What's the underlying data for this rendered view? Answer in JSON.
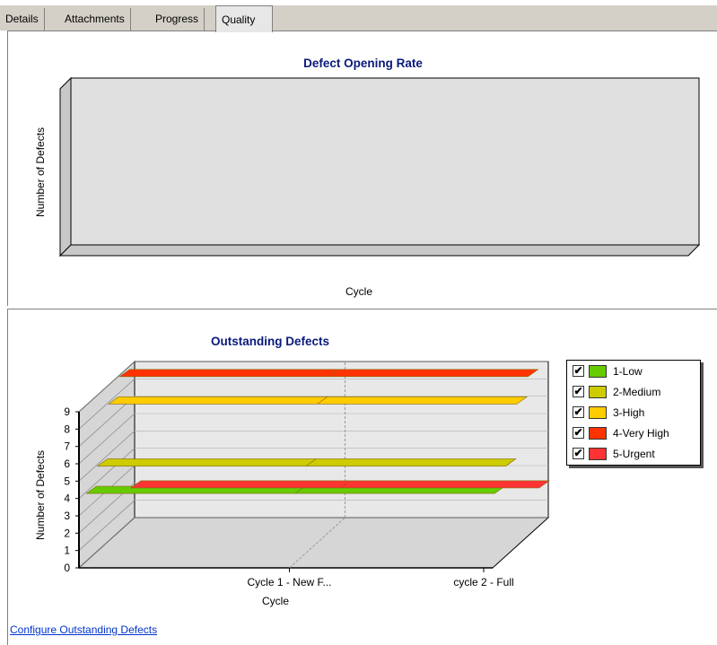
{
  "tabs": [
    {
      "label": "Details"
    },
    {
      "label": "Attachments"
    },
    {
      "label": "Progress"
    },
    {
      "label": "Quality",
      "active": true
    }
  ],
  "defect_opening_chart": {
    "title": "Defect Opening Rate",
    "xlabel": "Cycle",
    "ylabel": "Number of Defects"
  },
  "outstanding_chart": {
    "title": "Outstanding Defects",
    "xlabel": "Cycle",
    "ylabel": "Number of Defects"
  },
  "legend": {
    "items": [
      {
        "label": "1-Low",
        "checked": true,
        "color": "#66cc00"
      },
      {
        "label": "2-Medium",
        "checked": true,
        "color": "#cccc00"
      },
      {
        "label": "3-High",
        "checked": true,
        "color": "#ffcc00"
      },
      {
        "label": "4-Very High",
        "checked": true,
        "color": "#ff3300"
      },
      {
        "label": "5-Urgent",
        "checked": true,
        "color": "#ff3333"
      }
    ]
  },
  "configure_link": "Configure Outstanding Defects",
  "chart_data": [
    {
      "type": "line",
      "title": "Defect Opening Rate",
      "xlabel": "Cycle",
      "ylabel": "Number of Defects",
      "categories": [],
      "series": []
    },
    {
      "type": "line",
      "title": "Outstanding Defects",
      "xlabel": "Cycle",
      "ylabel": "Number of Defects",
      "ylim": [
        0,
        9
      ],
      "yticks": [
        0,
        1,
        2,
        3,
        4,
        5,
        6,
        7,
        8,
        9
      ],
      "categories": [
        "Cycle 1 - New F...",
        "cycle 2 - Full"
      ],
      "series": [
        {
          "name": "1-Low",
          "values": [
            4,
            4
          ],
          "color": "#66cc00"
        },
        {
          "name": "2-Medium",
          "values": [
            5,
            5
          ],
          "color": "#cccc00"
        },
        {
          "name": "3-High",
          "values": [
            8,
            8
          ],
          "color": "#ffcc00"
        },
        {
          "name": "4-Very High",
          "values": [
            9,
            9
          ],
          "color": "#ff3300"
        },
        {
          "name": "5-Urgent",
          "values": [
            2,
            2
          ],
          "color": "#ff3333"
        }
      ]
    }
  ]
}
